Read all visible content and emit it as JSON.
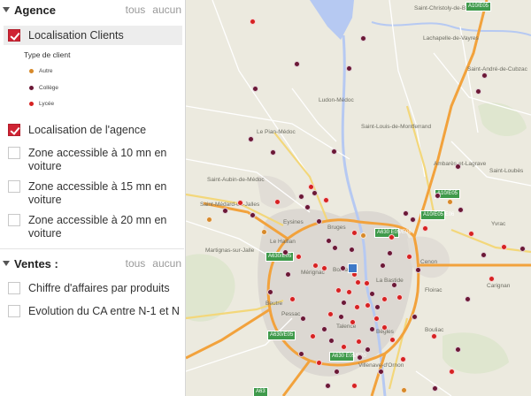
{
  "sidebar": {
    "agence": {
      "title": "Agence",
      "link_all": "tous",
      "link_none": "aucun",
      "items": [
        {
          "label": "Localisation Clients",
          "checked": true
        },
        {
          "label": "Localisation de l'agence",
          "checked": true
        },
        {
          "label": "Zone accessible à 10 mn en voiture",
          "checked": false
        },
        {
          "label": "Zone accessible à 15 mn en voiture",
          "checked": false
        },
        {
          "label": "Zone accessible à 20 mn en voiture",
          "checked": false
        }
      ],
      "legend": {
        "title": "Type de client",
        "items": [
          {
            "label": "Autre",
            "color": "#d7892a"
          },
          {
            "label": "Collège",
            "color": "#6b1836"
          },
          {
            "label": "Lycée",
            "color": "#d62222"
          }
        ]
      }
    },
    "ventes": {
      "title": "Ventes :",
      "link_all": "tous",
      "link_none": "aucun",
      "items": [
        {
          "label": "Chiffre d'affaires par produits",
          "checked": false
        },
        {
          "label": "Evolution du CA entre N-1 et N",
          "checked": false
        }
      ]
    }
  },
  "map": {
    "places": [
      {
        "name": "Saint-Christoly-de-Blaye"
      },
      {
        "name": "Lachapelle-de-Vayres"
      },
      {
        "name": "Saint-André-de-Cubzac"
      },
      {
        "name": "Ludon-Médoc"
      },
      {
        "name": "Le Pian-Médoc"
      },
      {
        "name": "Saint-Louis-de-Montferrand"
      },
      {
        "name": "Ambarès-et-Lagrave"
      },
      {
        "name": "Saint-Loubès"
      },
      {
        "name": "Saint-Aubin-de-Médoc"
      },
      {
        "name": "Saint-Médard-en-Jalles"
      },
      {
        "name": "Eysines"
      },
      {
        "name": "Bruges"
      },
      {
        "name": "Mérignac"
      },
      {
        "name": "Bordeaux"
      },
      {
        "name": "La Bastide"
      },
      {
        "name": "Cenon"
      },
      {
        "name": "Floirac"
      },
      {
        "name": "Pessac"
      },
      {
        "name": "Talence"
      },
      {
        "name": "Bègles"
      },
      {
        "name": "Villenave-d'Ornon"
      },
      {
        "name": "Le Haillan"
      },
      {
        "name": "Martignas-sur-Jalle"
      },
      {
        "name": "Yvrac"
      },
      {
        "name": "Carignan"
      },
      {
        "name": "Bouliac"
      },
      {
        "name": "Beutre"
      }
    ],
    "shields": [
      {
        "label": "A10/E05"
      },
      {
        "label": "A10/E05"
      },
      {
        "label": "A10/E05 E06"
      },
      {
        "label": "A630 E05/E06"
      },
      {
        "label": "A630/E05"
      },
      {
        "label": "A630/E05"
      },
      {
        "label": "A630 E05/E70"
      },
      {
        "label": "A63"
      }
    ]
  }
}
